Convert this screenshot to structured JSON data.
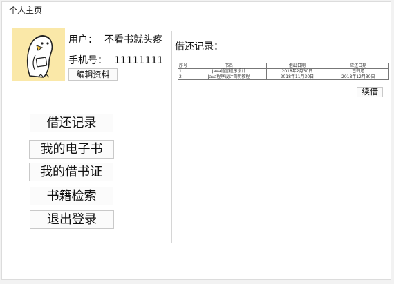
{
  "window": {
    "title": "个人主页"
  },
  "profile": {
    "user_label": "用户：",
    "user_name": "不看书就头疼",
    "phone_label": "手机号：",
    "phone_value": "11111111",
    "edit_label": "编辑资料"
  },
  "nav": [
    {
      "label": "借还记录"
    },
    {
      "label": "我的电子书"
    },
    {
      "label": "我的借书证"
    },
    {
      "label": "书籍检索"
    },
    {
      "label": "退出登录"
    }
  ],
  "records": {
    "title": "借还记录：",
    "columns": [
      "序号",
      "书名",
      "借出日期",
      "应还日期"
    ],
    "rows": [
      [
        "1",
        "Java语言程序设计",
        "2018年2月30日",
        "已归还"
      ],
      [
        "2",
        "Java程序设计简明教程",
        "2018年11月30日",
        "2018年12月30日"
      ]
    ],
    "renew_label": "续借"
  },
  "colors": {
    "avatar_bg": "#fae8a8",
    "page_bg": "#f2f2f2"
  }
}
